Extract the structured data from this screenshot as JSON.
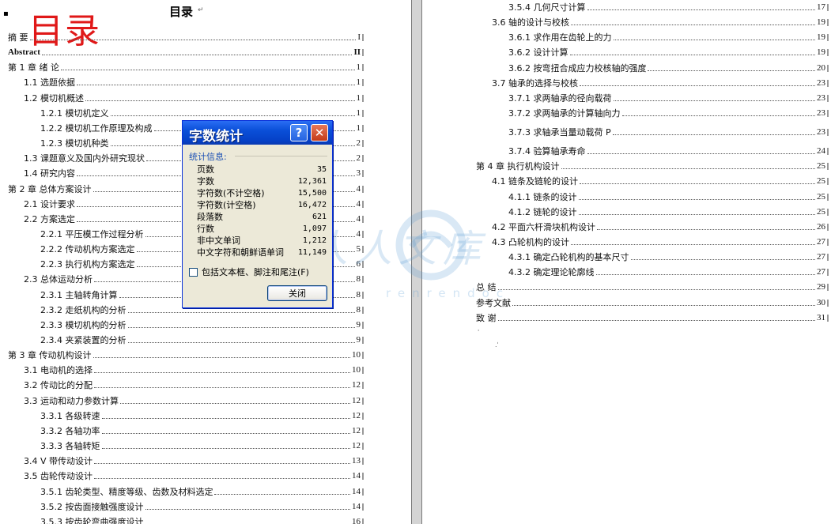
{
  "document": {
    "title": "目录",
    "title_mark": "↵",
    "stamp": "目录",
    "left_entries": [
      {
        "text": "摘 要",
        "page": "I"
      },
      {
        "text": "Abstract",
        "page": "II"
      },
      {
        "text": "第 1 章 绪 论",
        "page": "1"
      },
      {
        "text": "1.1 选题依据",
        "page": "1"
      },
      {
        "text": "1.2 模切机概述",
        "page": "1"
      },
      {
        "text": "1.2.1 模切机定义",
        "page": "1"
      },
      {
        "text": "1.2.2 模切机工作原理及构成",
        "page": "1"
      },
      {
        "text": "1.2.3 模切机种类",
        "page": "2"
      },
      {
        "text": "1.3 课题意义及国内外研究现状",
        "page": "2"
      },
      {
        "text": "1.4 研究内容",
        "page": "3"
      },
      {
        "text": "第 2 章 总体方案设计",
        "page": "4"
      },
      {
        "text": "2.1 设计要求",
        "page": "4"
      },
      {
        "text": "2.2 方案选定",
        "page": "4"
      },
      {
        "text": "2.2.1 平压模工作过程分析",
        "page": "4"
      },
      {
        "text": "2.2.2 传动机构方案选定",
        "page": "5"
      },
      {
        "text": "2.2.3 执行机构方案选定",
        "page": "6"
      },
      {
        "text": "2.3 总体运动分析",
        "page": "8"
      },
      {
        "text": "2.3.1 主轴转角计算",
        "page": "8"
      },
      {
        "text": "2.3.2 走纸机构的分析",
        "page": "8"
      },
      {
        "text": "2.3.3 模切机构的分析",
        "page": "9"
      },
      {
        "text": "2.3.4 夹紧装置的分析",
        "page": "9"
      },
      {
        "text": "第 3 章 传动机构设计",
        "page": "10"
      },
      {
        "text": "3.1 电动机的选择",
        "page": "10"
      },
      {
        "text": "3.2 传动比的分配",
        "page": "12"
      },
      {
        "text": "3.3 运动和动力参数计算",
        "page": "12"
      },
      {
        "text": "3.3.1 各级转速",
        "page": "12"
      },
      {
        "text": "3.3.2 各轴功率",
        "page": "12"
      },
      {
        "text": "3.3.3 各轴转矩",
        "page": "12"
      },
      {
        "text": "3.4 V 带传动设计",
        "page": "13"
      },
      {
        "text": "3.5 齿轮传动设计",
        "page": "14"
      },
      {
        "text": "3.5.1 齿轮类型、精度等级、齿数及材料选定",
        "page": "14"
      },
      {
        "text": "3.5.2 按齿面接触强度设计",
        "page": "14"
      },
      {
        "text": "3.5.3 按齿轮弯曲强度设计",
        "page": "16"
      }
    ],
    "right_entries": [
      {
        "text": "3.5.4 几何尺寸计算",
        "page": "17"
      },
      {
        "text": "3.6 轴的设计与校核",
        "page": "19"
      },
      {
        "text": "3.6.1 求作用在齿轮上的力",
        "page": "19"
      },
      {
        "text": "3.6.2 设计计算",
        "page": "19"
      },
      {
        "text": "3.6.2 按弯扭合成应力校核轴的强度",
        "page": "20"
      },
      {
        "text": "3.7 轴承的选择与校核",
        "page": "23"
      },
      {
        "text": "3.7.1 求两轴承的径向载荷",
        "page": "23"
      },
      {
        "text": "3.7.2 求两轴承的计算轴向力",
        "page": "23"
      },
      {
        "text": "3.7.3 求轴承当量动载荷 P",
        "page": "23"
      },
      {
        "text": "3.7.4 验算轴承寿命",
        "page": "24"
      },
      {
        "text": "第 4 章 执行机构设计",
        "page": "25"
      },
      {
        "text": "4.1 链条及链轮的设计",
        "page": "25"
      },
      {
        "text": "4.1.1 链条的设计",
        "page": "25"
      },
      {
        "text": "4.1.2 链轮的设计",
        "page": "25"
      },
      {
        "text": "4.2 平面六杆滑块机构设计",
        "page": "26"
      },
      {
        "text": "4.3 凸轮机构的设计",
        "page": "27"
      },
      {
        "text": "4.3.1 确定凸轮机构的基本尺寸",
        "page": "27"
      },
      {
        "text": "4.3.2 确定理论轮廓线",
        "page": "27"
      },
      {
        "text": "总 结",
        "page": "29"
      },
      {
        "text": "参考文献",
        "page": "30"
      },
      {
        "text": "致 谢",
        "page": "31"
      }
    ]
  },
  "watermark": {
    "text": "人人文库",
    "sub": "renrendoc"
  },
  "dialog": {
    "title": "字数统计",
    "help_label": "?",
    "close_label": "✕",
    "section_label": "统计信息:",
    "stats": [
      {
        "label": "页数",
        "value": "35"
      },
      {
        "label": "字数",
        "value": "12,361"
      },
      {
        "label": "字符数(不计空格)",
        "value": "15,500"
      },
      {
        "label": "字符数(计空格)",
        "value": "16,472"
      },
      {
        "label": "段落数",
        "value": "621"
      },
      {
        "label": "行数",
        "value": "1,097"
      },
      {
        "label": "非中文单词",
        "value": "1,212"
      },
      {
        "label": "中文字符和朝鲜语单词",
        "value": "11,149"
      }
    ],
    "checkbox_label": "包括文本框、脚注和尾注(F)",
    "button_label": "关闭"
  }
}
